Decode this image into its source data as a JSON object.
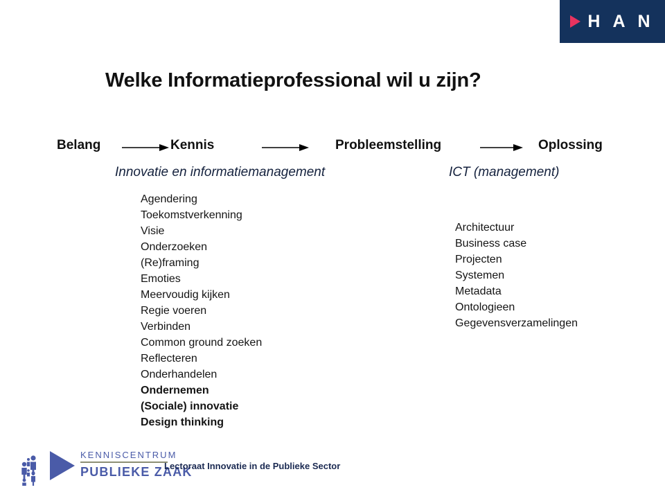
{
  "brand": {
    "name": "han-logo",
    "wordmark": "H A N",
    "triangle_icon": "play-triangle-icon",
    "background_color": "#14325c",
    "triangle_color": "#e8335f",
    "text_color": "#ffffff"
  },
  "slide": {
    "title": "Welke Informatieprofessional wil u zijn?",
    "title_color": "#111111"
  },
  "flow": {
    "stages": [
      {
        "label": "Belang"
      },
      {
        "label": "Kennis"
      },
      {
        "label": "Probleemstelling"
      },
      {
        "label": "Oplossing"
      }
    ],
    "arrow_icon": "arrow-right-icon",
    "arrow_color": "#000000"
  },
  "columns": [
    {
      "subtitle": "Innovatie en informatiemanagement",
      "subtitle_color": "#14213d",
      "items": [
        {
          "label": "Agendering",
          "bold": false
        },
        {
          "label": "Toekomstverkenning",
          "bold": false
        },
        {
          "label": "Visie",
          "bold": false
        },
        {
          "label": "Onderzoeken",
          "bold": false
        },
        {
          "label": "(Re)framing",
          "bold": false
        },
        {
          "label": "Emoties",
          "bold": false
        },
        {
          "label": "Meervoudig kijken",
          "bold": false
        },
        {
          "label": "Regie voeren",
          "bold": false
        },
        {
          "label": "Verbinden",
          "bold": false
        },
        {
          "label": "Common ground zoeken",
          "bold": false
        },
        {
          "label": "Reflecteren",
          "bold": false
        },
        {
          "label": "Onderhandelen",
          "bold": false
        },
        {
          "label": "Ondernemen",
          "bold": true
        },
        {
          "label": "(Sociale) innovatie",
          "bold": true
        },
        {
          "label": "Design thinking",
          "bold": true
        }
      ]
    },
    {
      "subtitle": "ICT (management)",
      "subtitle_color": "#14213d",
      "items": [
        {
          "label": "Architectuur",
          "bold": false
        },
        {
          "label": "Business case",
          "bold": false
        },
        {
          "label": "Projecten",
          "bold": false
        },
        {
          "label": "Systemen",
          "bold": false
        },
        {
          "label": "Metadata",
          "bold": false
        },
        {
          "label": "Ontologieen",
          "bold": false
        },
        {
          "label": "Gegevensverzamelingen",
          "bold": false
        }
      ]
    }
  ],
  "footer": {
    "logo": {
      "name": "kenniscentrum-publieke-zaak-logo",
      "line1": "KENNISCENTRUM",
      "line2": "PUBLIEKE ZAAK",
      "figures_icon": "people-group-icon",
      "triangle_icon": "play-triangle-icon",
      "logo_color": "#4a5ba8",
      "rule_color": "#8d8f74"
    },
    "caption": "Lectoraat Innovatie in de Publieke Sector",
    "caption_color": "#1b2a52"
  }
}
